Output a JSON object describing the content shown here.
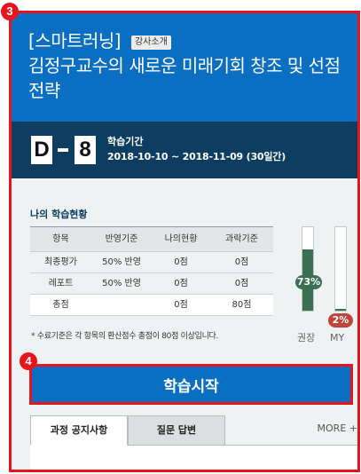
{
  "badges": {
    "top": "3",
    "start": "4"
  },
  "course": {
    "title": "[스마트러닝]",
    "tag": "강사소개",
    "title_rest": "김정구교수의 새로운 미래기회 창조 및 선점전략"
  },
  "period": {
    "d_letter": "D",
    "d_number": "8",
    "label": "학습기간",
    "dates": "2018-10-10 ~ 2018-11-09 (30일간)"
  },
  "status": {
    "title": "나의 학습현황",
    "headers": [
      "항목",
      "반영기준",
      "나의현황",
      "과락기준"
    ],
    "rows": [
      [
        "최종평가",
        "50% 반영",
        "0점",
        "0점"
      ],
      [
        "레포트",
        "50% 반영",
        "0점",
        "0점"
      ],
      [
        "총점",
        "",
        "0점",
        "80점"
      ]
    ],
    "footnote": "* 수료기준은 각 항목의 환산점수 총점이 80점 이상입니다."
  },
  "gauges": {
    "recommended": {
      "label": "권장",
      "percent_text": "73%",
      "value": 0.73
    },
    "mine": {
      "label": "MY",
      "percent_text": "2%",
      "value": 0.02
    },
    "colors": {
      "recommended": "#3b7152",
      "mine": "#c0443c"
    }
  },
  "actions": {
    "start_label": "학습시작"
  },
  "tabs": {
    "items": [
      "과정 공지사항",
      "질문 답변"
    ],
    "more_label": "MORE +"
  },
  "colors": {
    "brand_blue": "#0a6fc3",
    "navy": "#0e3d62",
    "highlight_red": "#e8141c"
  }
}
